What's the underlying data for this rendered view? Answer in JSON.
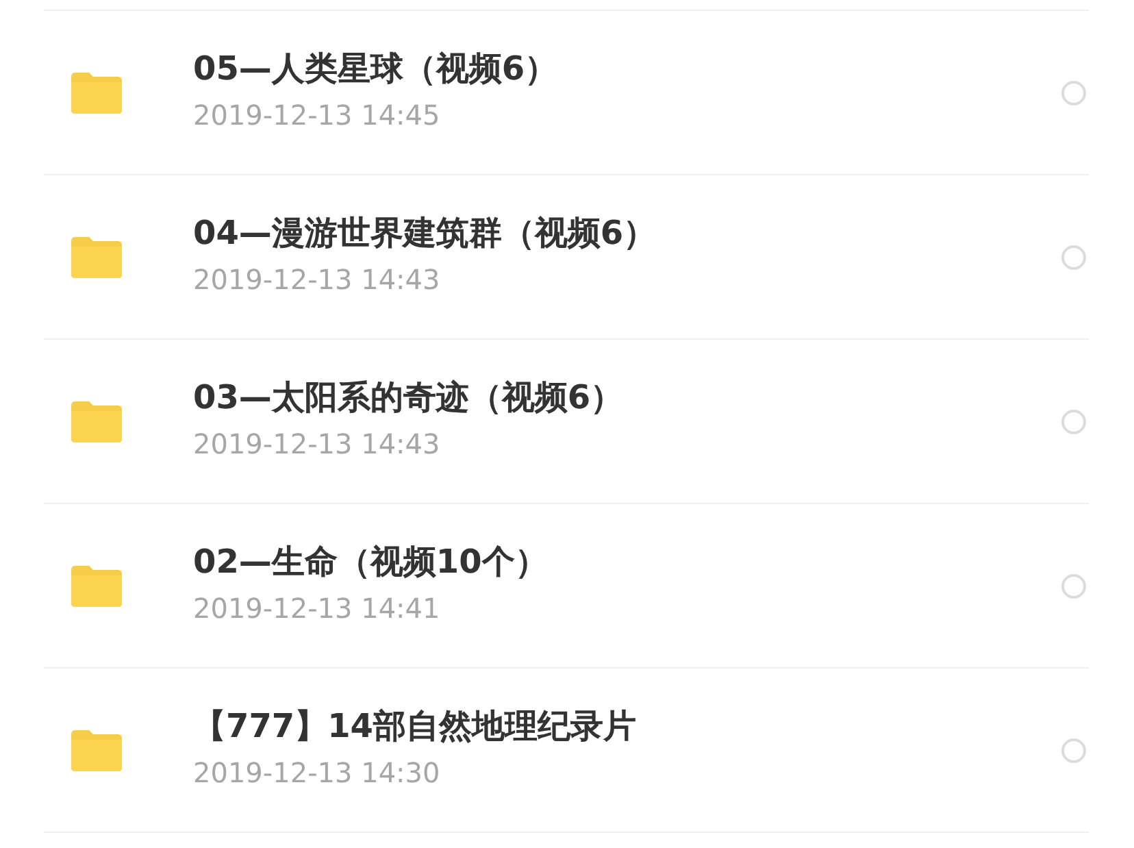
{
  "folders": [
    {
      "name": "05—人类星球（视频6）",
      "date": "2019-12-13 14:45",
      "selected": false
    },
    {
      "name": "04—漫游世界建筑群（视频6）",
      "date": "2019-12-13 14:43",
      "selected": false
    },
    {
      "name": "03—太阳系的奇迹（视频6）",
      "date": "2019-12-13 14:43",
      "selected": false
    },
    {
      "name": "02—生命（视频10个）",
      "date": "2019-12-13 14:41",
      "selected": false
    },
    {
      "name": "【777】14部自然地理纪录片",
      "date": "2019-12-13 14:30",
      "selected": false
    }
  ]
}
